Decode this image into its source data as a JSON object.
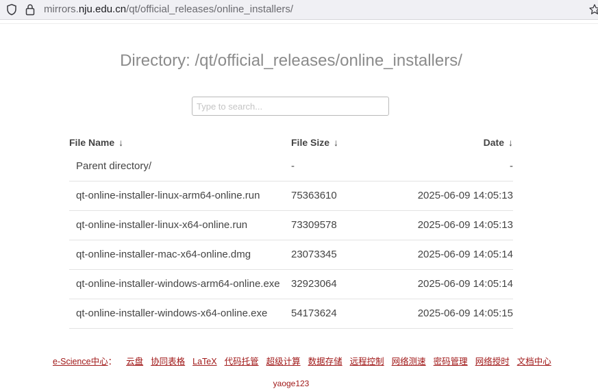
{
  "browser": {
    "url_prefix": "mirrors.",
    "url_host": "nju.edu.cn",
    "url_path": "/qt/official_releases/online_installers/"
  },
  "page": {
    "title": "Directory: /qt/official_releases/online_installers/",
    "search_placeholder": "Type to search..."
  },
  "table": {
    "headers": {
      "name": "File Name",
      "size": "File Size",
      "date": "Date",
      "sort_arrow": "↓"
    },
    "rows": [
      {
        "name": "Parent directory/",
        "size": "-",
        "date": "-"
      },
      {
        "name": "qt-online-installer-linux-arm64-online.run",
        "size": "75363610",
        "date": "2025-06-09 14:05:13"
      },
      {
        "name": "qt-online-installer-linux-x64-online.run",
        "size": "73309578",
        "date": "2025-06-09 14:05:13"
      },
      {
        "name": "qt-online-installer-mac-x64-online.dmg",
        "size": "23073345",
        "date": "2025-06-09 14:05:14"
      },
      {
        "name": "qt-online-installer-windows-arm64-online.exe",
        "size": "32923064",
        "date": "2025-06-09 14:05:14"
      },
      {
        "name": "qt-online-installer-windows-x64-online.exe",
        "size": "54173624",
        "date": "2025-06-09 14:05:15"
      }
    ]
  },
  "footer": {
    "lead": "e-Science中心",
    "lead_sep": "：",
    "links": [
      "云盘",
      "协同表格",
      "LaTeX",
      "代码托管",
      "超级计算",
      "数据存储",
      "远程控制",
      "网络测速",
      "密码管理",
      "网络授时",
      "文档中心"
    ],
    "user": "yaoge123"
  },
  "colors": {
    "link": "#a01818",
    "title": "#8b8b8b",
    "text": "#444444"
  },
  "icons": [
    "shield-icon",
    "lock-icon",
    "bookmark-star-icon"
  ]
}
